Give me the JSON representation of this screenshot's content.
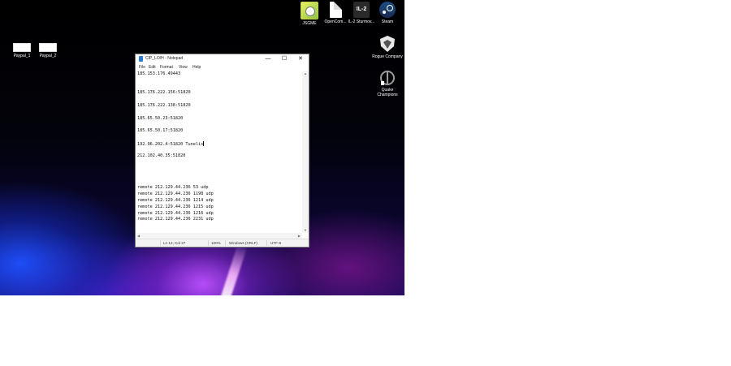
{
  "desktop": {
    "icons": [
      {
        "label": "Paypal_1"
      },
      {
        "label": "Paypal_2"
      },
      {
        "label": "JSGME"
      },
      {
        "label": "OpenCom..."
      },
      {
        "label": "IL-2 Sturmov...",
        "badge": "IL-2"
      },
      {
        "label": "Steam"
      },
      {
        "label": "Rogue Company"
      },
      {
        "label": "Quake Champions"
      }
    ]
  },
  "notepad": {
    "title": "CIP_LO/H - Notepad",
    "controls": {
      "minimize": "—",
      "maximize": "☐",
      "close": "✕"
    },
    "menu": [
      "File",
      "Edit",
      "Format",
      "View",
      "Help"
    ],
    "lines": [
      "185.153.176.49443",
      "",
      "",
      "185.176.222.156:51820",
      "",
      "185.176.222.138:51820",
      "",
      "185.65.50.23:51820",
      "",
      "185.65.50.17:51820",
      "",
      "192.96.202.4:51820 Tunelis",
      "",
      "212.102.40.35:51820",
      "",
      "",
      "",
      "",
      "remote 212.129.44.236 53 udp",
      "remote 212.129.44.236 1198 udp",
      "remote 212.129.44.236 1214 udp",
      "remote 212.129.44.236 1215 udp",
      "remote 212.129.44.236 1216 udp",
      "remote 212.129.44.236 2231 udp"
    ],
    "status": {
      "position": "Ln 12, Col 27",
      "zoom": "100%",
      "line_ending": "Windows (CRLF)",
      "encoding": "UTF-8"
    }
  }
}
